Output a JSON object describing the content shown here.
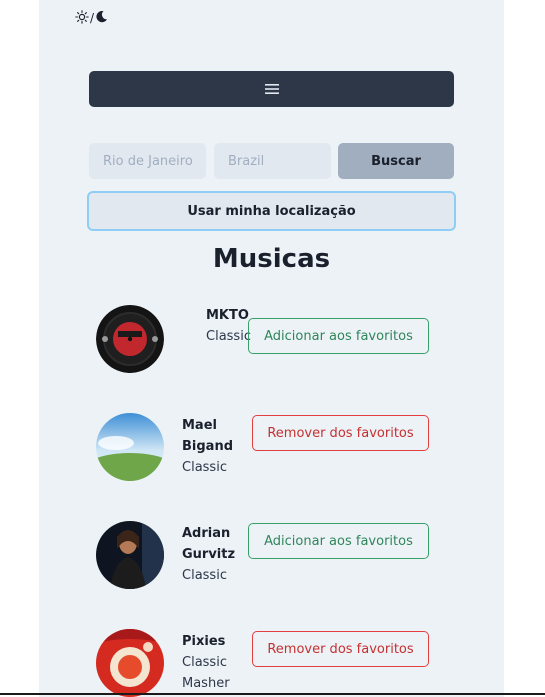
{
  "theme_toggle": {
    "sun_icon": "sun-icon",
    "separator": "/",
    "moon_icon": "moon-icon"
  },
  "menu": {
    "icon": "hamburger-icon"
  },
  "search": {
    "city_placeholder": "Rio de Janeiro",
    "country_placeholder": "Brazil",
    "button_label": "Buscar"
  },
  "location_button": "Usar minha localização",
  "heading": "Musicas",
  "tracks": [
    {
      "name": "MKTO",
      "name_line2": "",
      "genre": "Classic",
      "genre_line2": "",
      "button": "Adicionar aos favoritos",
      "action": "add"
    },
    {
      "name": "Mael",
      "name_line2": "Bigand",
      "genre": "Classic",
      "genre_line2": "",
      "button": "Remover dos favoritos",
      "action": "remove"
    },
    {
      "name": "Adrian",
      "name_line2": "Gurvitz",
      "genre": "Classic",
      "genre_line2": "",
      "button": "Adicionar aos favoritos",
      "action": "add"
    },
    {
      "name": "Pixies",
      "name_line2": "",
      "genre": "Classic",
      "genre_line2": "Masher",
      "button": "Remover dos favoritos",
      "action": "remove"
    }
  ],
  "colors": {
    "panel_bg": "#edf2f7",
    "menu_bg": "#2d3748",
    "add_green": "#38a169",
    "remove_red": "#e53e3e",
    "focus_ring": "#90cdf4"
  }
}
